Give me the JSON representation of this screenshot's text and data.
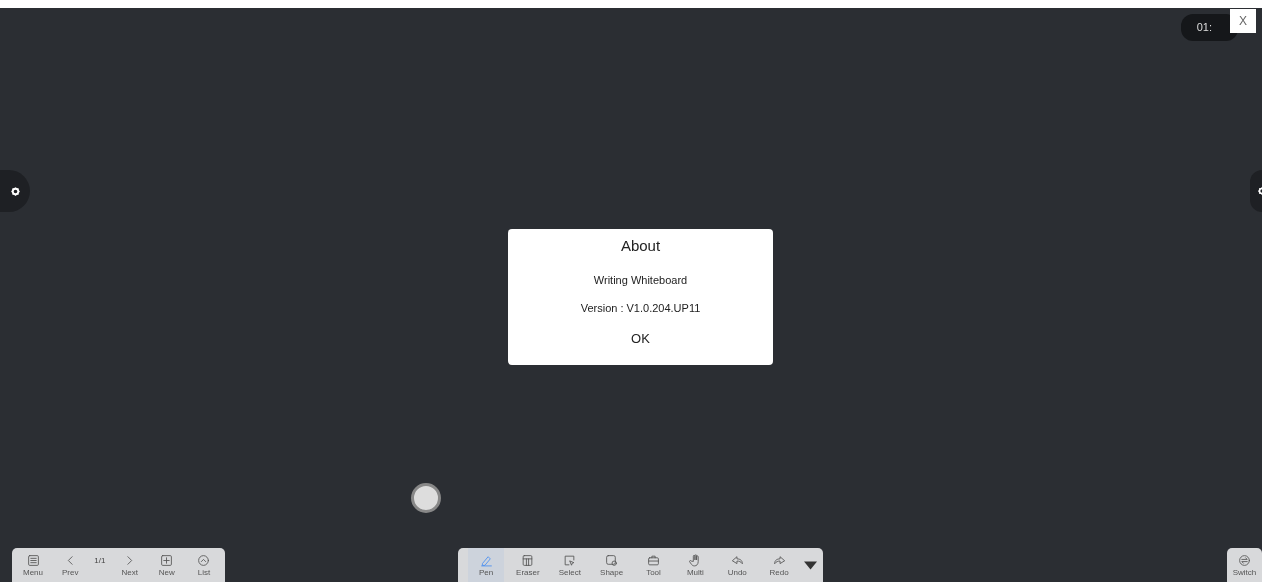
{
  "clock": {
    "text": "01:"
  },
  "close_button": {
    "label": "X"
  },
  "dialog": {
    "title": "About",
    "app_name": "Writing Whiteboard",
    "version": "Version : V1.0.204.UP11",
    "ok_button": "OK"
  },
  "page_bar": {
    "items": [
      {
        "kind": "button",
        "label": "Menu"
      },
      {
        "kind": "button",
        "label": "Prev"
      },
      {
        "kind": "counter",
        "text": "1/1"
      },
      {
        "kind": "button",
        "label": "Next"
      },
      {
        "kind": "button",
        "label": "New"
      },
      {
        "kind": "button",
        "label": "List"
      }
    ]
  },
  "tool_bar": {
    "tools": [
      {
        "label": "Pen",
        "selected": true
      },
      {
        "label": "Eraser",
        "selected": false
      },
      {
        "label": "Select",
        "selected": false
      },
      {
        "label": "Shape",
        "selected": false
      },
      {
        "label": "Tool",
        "selected": false
      },
      {
        "label": "Multi",
        "selected": false
      },
      {
        "label": "Undo",
        "selected": false
      },
      {
        "label": "Redo",
        "selected": false
      }
    ]
  },
  "switch_button": {
    "label": "Switch"
  }
}
